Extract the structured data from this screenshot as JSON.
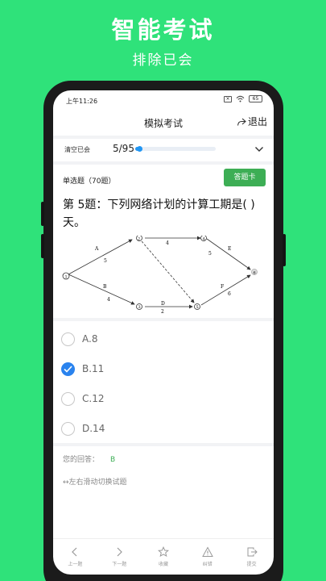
{
  "promo": {
    "title": "智能考试",
    "subtitle": "排除已会"
  },
  "status": {
    "time": "上午11:26",
    "sim": "×",
    "battery": "65"
  },
  "header": {
    "title": "模拟考试",
    "exit_label": "退出"
  },
  "progress": {
    "clear_label": "清空已会",
    "count": "5/95",
    "fraction": 0.053
  },
  "question": {
    "type": "单选题（70题）",
    "card_label": "答题卡",
    "text": "第 5题：下列网络计划的计算工期是(    )天。"
  },
  "diagram": {
    "nodes": [
      "1",
      "2",
      "3",
      "4",
      "5",
      "6"
    ],
    "activities": [
      {
        "name": "A",
        "duration": "5"
      },
      {
        "name": "B",
        "duration": "4"
      },
      {
        "name": "C",
        "duration": "4"
      },
      {
        "name": "D",
        "duration": "2"
      },
      {
        "name": "E",
        "duration": "5"
      },
      {
        "name": "F",
        "duration": "6"
      }
    ]
  },
  "options": [
    {
      "label": "A.8",
      "checked": false
    },
    {
      "label": "B.11",
      "checked": true
    },
    {
      "label": "C.12",
      "checked": false
    },
    {
      "label": "D.14",
      "checked": false
    }
  ],
  "answer": {
    "label": "您的回答：",
    "value": "B"
  },
  "hint": "↔左右滑动切换试题",
  "nav": [
    {
      "label": "上一题",
      "icon": "chevron-left-icon"
    },
    {
      "label": "下一题",
      "icon": "chevron-right-icon"
    },
    {
      "label": "收藏",
      "icon": "star-icon"
    },
    {
      "label": "纠错",
      "icon": "warning-icon"
    },
    {
      "label": "提交",
      "icon": "submit-icon"
    }
  ],
  "colors": {
    "background": "#2fe27a",
    "accent": "#2196f3",
    "primary_green": "#3dae55",
    "check_blue": "#2a83ee"
  }
}
